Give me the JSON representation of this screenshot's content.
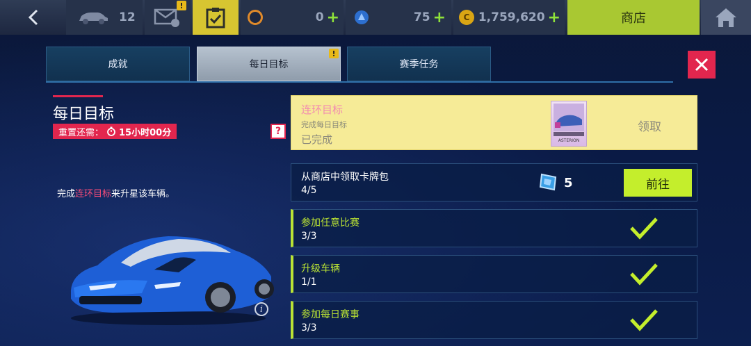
{
  "topbar": {
    "cars_count": "12",
    "res1_value": "0",
    "res2_value": "75",
    "credits_value": "1,759,620",
    "shop_label": "商店",
    "badge_mark": "!"
  },
  "tabs": [
    {
      "label": "成就",
      "active": false
    },
    {
      "label": "每日目标",
      "active": true
    },
    {
      "label": "赛季任务",
      "active": false
    }
  ],
  "left": {
    "title": "每日目标",
    "reset_label": "重置还需：",
    "reset_time": "15小时00分",
    "help_mark": "?",
    "desc_prefix": "完成",
    "desc_highlight": "连环目标",
    "desc_suffix": "来升星该车辆。",
    "info_mark": "i"
  },
  "chain": {
    "title": "连环目标",
    "subtitle": "完成每日目标",
    "status": "已完成",
    "claim_label": "领取",
    "card_name": "ASTERION"
  },
  "pack_task": {
    "name": "从商店中领取卡牌包",
    "progress": "4/5",
    "reward_count": "5",
    "go_label": "前往"
  },
  "tasks": [
    {
      "name": "参加任意比赛",
      "progress": "3/3"
    },
    {
      "name": "升级车辆",
      "progress": "1/1"
    },
    {
      "name": "参加每日赛事",
      "progress": "3/3"
    }
  ],
  "colors": {
    "accent": "#e2264e",
    "lime": "#c4ee2c",
    "chain_bg": "#f6eb97"
  }
}
